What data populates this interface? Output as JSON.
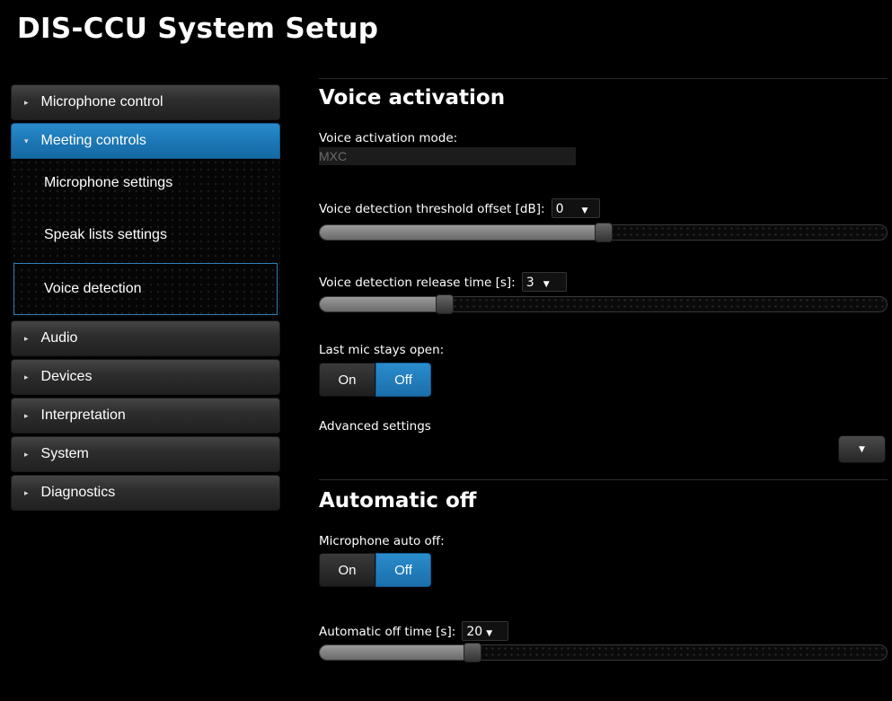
{
  "app": {
    "title": "DIS-CCU System Setup"
  },
  "sidebar": {
    "items": [
      {
        "label": "Microphone control",
        "icon": "caret-right-icon"
      },
      {
        "label": "Meeting controls",
        "icon": "caret-down-icon",
        "active": true,
        "subitems": [
          {
            "label": "Microphone settings"
          },
          {
            "label": "Speak lists settings"
          },
          {
            "label": "Voice detection",
            "selected": true
          }
        ]
      },
      {
        "label": "Audio",
        "icon": "caret-right-icon"
      },
      {
        "label": "Devices",
        "icon": "caret-right-icon"
      },
      {
        "label": "Interpretation",
        "icon": "caret-right-icon"
      },
      {
        "label": "System",
        "icon": "caret-right-icon"
      },
      {
        "label": "Diagnostics",
        "icon": "caret-right-icon"
      }
    ]
  },
  "voice_activation": {
    "title": "Voice activation",
    "mode_label": "Voice activation mode:",
    "mode_value": "MXC",
    "threshold": {
      "label": "Voice detection threshold offset [dB]:",
      "value": "0",
      "level_percent": 50
    },
    "release": {
      "label": "Voice detection release time [s]:",
      "value": "3",
      "level_percent": 22
    },
    "last_mic": {
      "label": "Last mic stays open:",
      "on_label": "On",
      "off_label": "Off",
      "selected": "Off"
    },
    "advanced_label": "Advanced settings"
  },
  "automatic_off": {
    "title": "Automatic off",
    "auto_off": {
      "label": "Microphone auto off:",
      "on_label": "On",
      "off_label": "Off",
      "selected": "Off"
    },
    "time": {
      "label": "Automatic off time [s]:",
      "value": "20",
      "level_percent": 27
    }
  },
  "colors": {
    "accent": "#1a7dc0",
    "background": "#000000"
  }
}
